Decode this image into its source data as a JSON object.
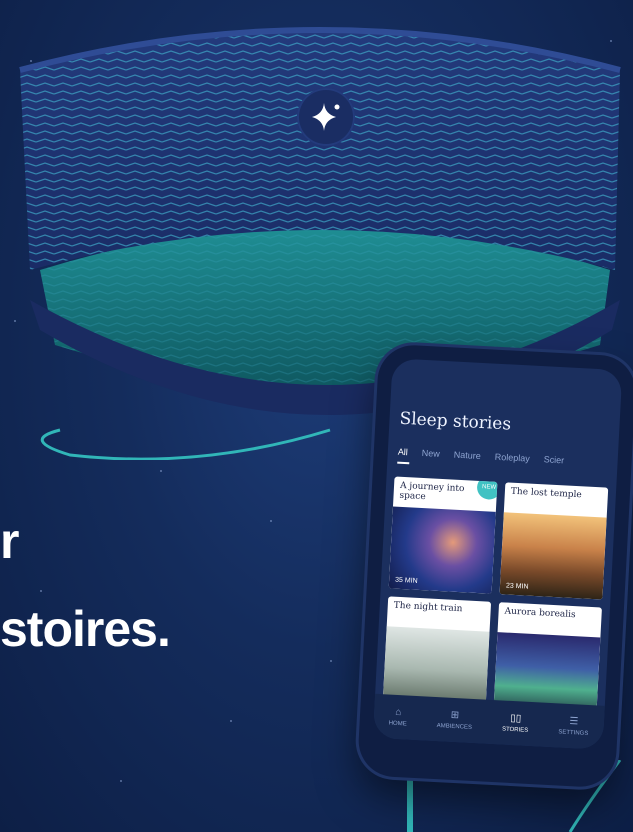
{
  "headline": {
    "line1_fragment": "r",
    "line2_fragment": "stoires."
  },
  "app": {
    "title": "Sleep stories",
    "tabs": [
      "All",
      "New",
      "Nature",
      "Roleplay",
      "Scier"
    ],
    "cards": [
      {
        "title": "A journey into space",
        "duration": "35 MIN",
        "badge": "NEW"
      },
      {
        "title": "The lost temple",
        "duration": "23 MIN"
      },
      {
        "title": "The night train"
      },
      {
        "title": "Aurora borealis"
      }
    ],
    "nav": [
      {
        "label": "HOME",
        "icon": "home-icon"
      },
      {
        "label": "AMBIENCES",
        "icon": "grid-icon"
      },
      {
        "label": "STORIES",
        "icon": "book-icon"
      },
      {
        "label": "SETTINGS",
        "icon": "menu-icon"
      }
    ]
  },
  "colors": {
    "background": "#142c5c",
    "accent": "#40c2c3",
    "headband": "#1f3470"
  }
}
